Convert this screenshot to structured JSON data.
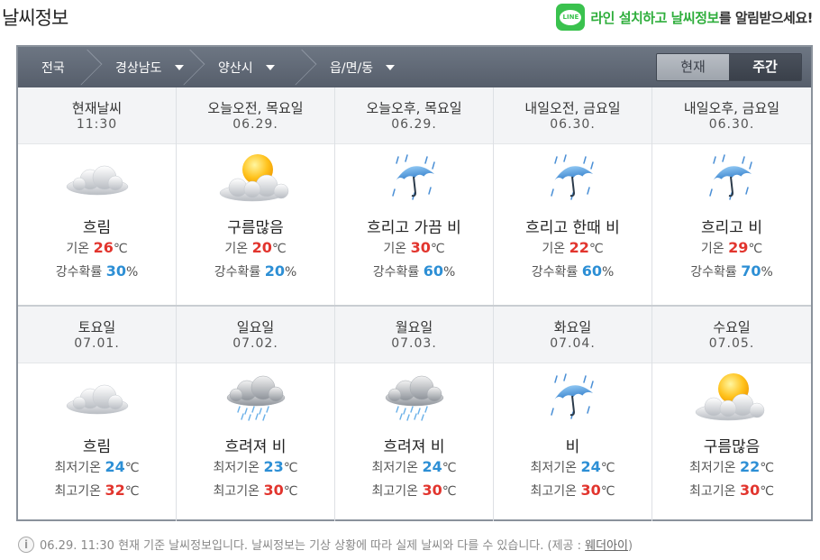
{
  "page_title": "날씨정보",
  "promo": {
    "green_text": "라인 설치하고 날씨정보",
    "rest_text": "를 알림받으세요!",
    "logo": "LINE"
  },
  "breadcrumb": [
    {
      "label": "전국",
      "dropdown": false
    },
    {
      "label": "경상남도",
      "dropdown": true
    },
    {
      "label": "양산시",
      "dropdown": true
    },
    {
      "label": "읍/면/동",
      "dropdown": true
    }
  ],
  "toggle": {
    "now": "현재",
    "week": "주간",
    "selected": "week"
  },
  "current": [
    {
      "title": "현재날씨",
      "sub": "11:30",
      "icon": "cloudy-icon",
      "condition": "흐림",
      "temp_label": "기온",
      "temp": "26",
      "unit": "℃",
      "rain_label": "강수확률",
      "rain": "30",
      "rain_unit": "%"
    },
    {
      "title": "오늘오전, 목요일",
      "sub": "06.29.",
      "icon": "sun-cloud-icon",
      "condition": "구름많음",
      "temp_label": "기온",
      "temp": "20",
      "unit": "℃",
      "rain_label": "강수확률",
      "rain": "20",
      "rain_unit": "%"
    },
    {
      "title": "오늘오후, 목요일",
      "sub": "06.29.",
      "icon": "umbrella-rain-icon",
      "condition": "흐리고 가끔 비",
      "temp_label": "기온",
      "temp": "30",
      "unit": "℃",
      "rain_label": "강수확률",
      "rain": "60",
      "rain_unit": "%"
    },
    {
      "title": "내일오전, 금요일",
      "sub": "06.30.",
      "icon": "umbrella-rain-icon",
      "condition": "흐리고 한때 비",
      "temp_label": "기온",
      "temp": "22",
      "unit": "℃",
      "rain_label": "강수확률",
      "rain": "60",
      "rain_unit": "%"
    },
    {
      "title": "내일오후, 금요일",
      "sub": "06.30.",
      "icon": "umbrella-rain-icon",
      "condition": "흐리고 비",
      "temp_label": "기온",
      "temp": "29",
      "unit": "℃",
      "rain_label": "강수확률",
      "rain": "70",
      "rain_unit": "%"
    }
  ],
  "weekly": [
    {
      "title": "토요일",
      "sub": "07.01.",
      "icon": "cloudy-icon",
      "condition": "흐림",
      "min_label": "최저기온",
      "min": "24",
      "max_label": "최고기온",
      "max": "32",
      "unit": "℃"
    },
    {
      "title": "일요일",
      "sub": "07.02.",
      "icon": "cloud-rain-icon",
      "condition": "흐려져 비",
      "min_label": "최저기온",
      "min": "23",
      "max_label": "최고기온",
      "max": "30",
      "unit": "℃"
    },
    {
      "title": "월요일",
      "sub": "07.03.",
      "icon": "cloud-rain-icon",
      "condition": "흐려져 비",
      "min_label": "최저기온",
      "min": "24",
      "max_label": "최고기온",
      "max": "30",
      "unit": "℃"
    },
    {
      "title": "화요일",
      "sub": "07.04.",
      "icon": "umbrella-rain-icon",
      "condition": "비",
      "min_label": "최저기온",
      "min": "24",
      "max_label": "최고기온",
      "max": "30",
      "unit": "℃"
    },
    {
      "title": "수요일",
      "sub": "07.05.",
      "icon": "sun-cloud-icon",
      "condition": "구름많음",
      "min_label": "최저기온",
      "min": "22",
      "max_label": "최고기온",
      "max": "30",
      "unit": "℃"
    }
  ],
  "footer": {
    "text": "06.29. 11:30 현재 기준 날씨정보입니다. 날씨정보는 기상 상황에 따라 실제 날씨와 다를 수 있습니다. (제공 : ",
    "provider": "웨더아이",
    "close": ")"
  }
}
